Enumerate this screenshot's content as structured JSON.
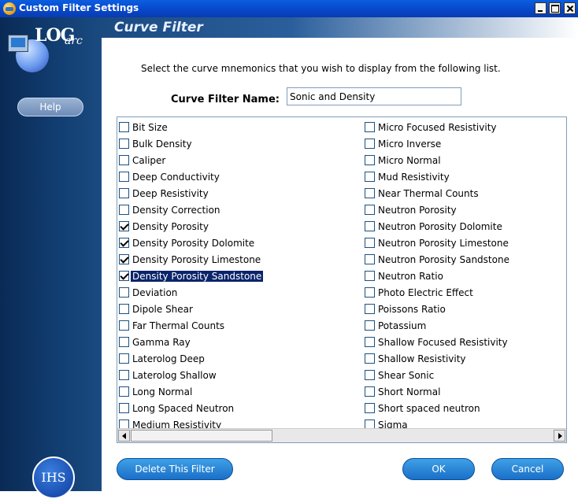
{
  "window": {
    "title": "Custom Filter Settings"
  },
  "sidebar": {
    "logo_text": "LOG",
    "logo_sub": "arc",
    "help_label": "Help",
    "brand_text": "IHS"
  },
  "header": {
    "title": "Curve Filter"
  },
  "instruction": "Select the curve mnemonics that you wish to display from the following list.",
  "filter_name": {
    "label": "Curve Filter Name:",
    "value": "Sonic and Density"
  },
  "curves_left": [
    {
      "label": "Bit Size",
      "checked": false
    },
    {
      "label": "Bulk Density",
      "checked": false
    },
    {
      "label": "Caliper",
      "checked": false
    },
    {
      "label": "Deep Conductivity",
      "checked": false
    },
    {
      "label": "Deep Resistivity",
      "checked": false
    },
    {
      "label": "Density Correction",
      "checked": false
    },
    {
      "label": "Density Porosity",
      "checked": true
    },
    {
      "label": "Density Porosity Dolomite",
      "checked": true
    },
    {
      "label": "Density Porosity Limestone",
      "checked": true
    },
    {
      "label": "Density Porosity Sandstone",
      "checked": true,
      "selected": true
    },
    {
      "label": "Deviation",
      "checked": false
    },
    {
      "label": "Dipole Shear",
      "checked": false
    },
    {
      "label": "Far Thermal Counts",
      "checked": false
    },
    {
      "label": "Gamma Ray",
      "checked": false
    },
    {
      "label": "Laterolog Deep",
      "checked": false
    },
    {
      "label": "Laterolog Shallow",
      "checked": false
    },
    {
      "label": "Long Normal",
      "checked": false
    },
    {
      "label": "Long Spaced Neutron",
      "checked": false
    },
    {
      "label": "Medium Resistivity",
      "checked": false
    }
  ],
  "curves_right": [
    {
      "label": "Micro Focused Resistivity",
      "checked": false
    },
    {
      "label": "Micro Inverse",
      "checked": false
    },
    {
      "label": "Micro Normal",
      "checked": false
    },
    {
      "label": "Mud Resistivity",
      "checked": false
    },
    {
      "label": "Near Thermal Counts",
      "checked": false
    },
    {
      "label": "Neutron Porosity",
      "checked": false
    },
    {
      "label": "Neutron Porosity Dolomite",
      "checked": false
    },
    {
      "label": "Neutron Porosity Limestone",
      "checked": false
    },
    {
      "label": "Neutron Porosity Sandstone",
      "checked": false
    },
    {
      "label": "Neutron Ratio",
      "checked": false
    },
    {
      "label": "Photo Electric Effect",
      "checked": false
    },
    {
      "label": "Poissons Ratio",
      "checked": false
    },
    {
      "label": "Potassium",
      "checked": false
    },
    {
      "label": "Shallow Focused Resistivity",
      "checked": false
    },
    {
      "label": "Shallow Resistivity",
      "checked": false
    },
    {
      "label": "Shear Sonic",
      "checked": false
    },
    {
      "label": "Short Normal",
      "checked": false
    },
    {
      "label": "Short spaced neutron",
      "checked": false
    },
    {
      "label": "Sigma",
      "checked": false
    }
  ],
  "buttons": {
    "delete": "Delete This Filter",
    "ok": "OK",
    "cancel": "Cancel"
  }
}
